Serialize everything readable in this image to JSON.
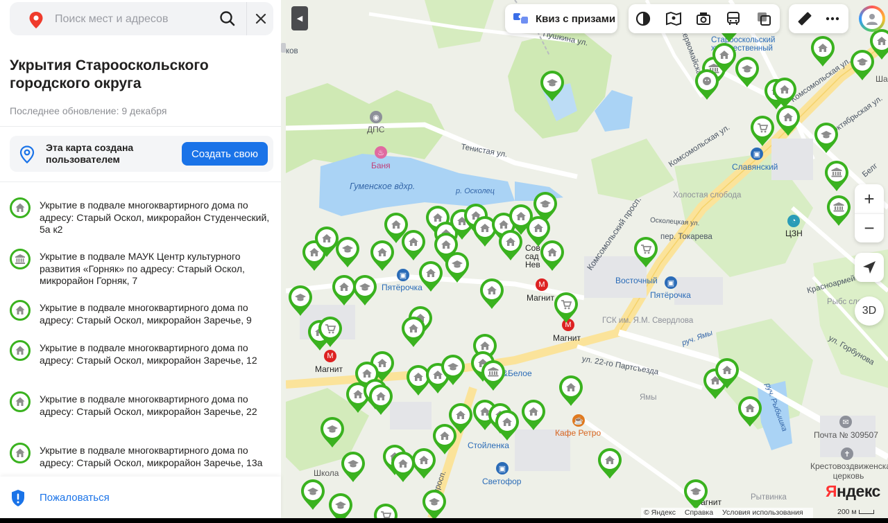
{
  "search": {
    "placeholder": "Поиск мест и адресов"
  },
  "sidebar": {
    "title": "Укрытия Старооскольского городского округа",
    "updated": "Последнее обновление: 9 декабря",
    "user_map_text": "Эта карта создана пользователем",
    "create_button": "Создать свою",
    "complain": "Пожаловаться",
    "items": [
      {
        "icon": "house-icon",
        "text": "Укрытие в подвале многоквартирного дома по адресу: Старый Оскол, микрорайон Студенческий, 5а к2"
      },
      {
        "icon": "museum-icon",
        "text": "Укрытие в подвале МАУК Центр культурного развития «Горняк» по адресу: Старый Оскол, микрорайон Горняк, 7"
      },
      {
        "icon": "house-icon",
        "text": "Укрытие в подвале многоквартирного дома по адресу: Старый Оскол, микрорайон Заречье, 9"
      },
      {
        "icon": "house-icon",
        "text": "Укрытие в подвале многоквартирного дома по адресу: Старый Оскол, микрорайон Заречье, 12"
      },
      {
        "icon": "house-icon",
        "text": "Укрытие в подвале многоквартирного дома по адресу: Старый Оскол, микрорайон Заречье, 22"
      },
      {
        "icon": "house-icon",
        "text": "Укрытие в подвале многоквартирного дома по адресу: Старый Оскол, микрорайон Заречье, 13а"
      }
    ]
  },
  "map": {
    "quiz_label": "Квиз с призами",
    "zoom_in": "+",
    "zoom_out": "−",
    "btn_3d": "3D",
    "logo": "Яндекс",
    "footer": {
      "copyright": "© Яндекс",
      "help": "Справка",
      "terms": "Условия использования"
    },
    "scale": "200 м",
    "marker_color": "#3ab21f",
    "labels": {
      "tenistaya": "Тенистая ул.",
      "gumenskoe": "Гуменское вдхр.",
      "oskolets": "р. Осколец",
      "dps": "ДПС",
      "banya": "Баня",
      "pyaterochka1": "Пятёрочка",
      "pyaterochka2": "Пятёрочка",
      "magnit1": "Магнит",
      "magnit2": "Магнит",
      "magnit3": "Магнит",
      "magnit4": "Магнит",
      "komsomolsky": "Комсомольский просп.",
      "komsomolskaya": "Комсомольская ул.",
      "komsomolskaya2": "Комсомольская ул.",
      "oktyabrskaya": "Октябрьская ул.",
      "osk_naber": "Осколецкая ул.",
      "tokareva": "пер. Токарева",
      "vostochny": "Восточный",
      "slavyansky": "Славянский",
      "czn": "ЦЗН",
      "kholostaya": "Холостая слобода",
      "gsk": "ГСК им. Я.М. Свердлова",
      "partsyezda": "ул. 22-го Партсъезда",
      "ruch_yamy": "руч. Ямы",
      "yamy": "Ямы",
      "ruch_rybyshka": "руч. Рыбышка",
      "gorbunova": "ул. Горбунова",
      "krasnoarm": "Красноармейская",
      "pochta": "Почта № 309507",
      "church": "Крестовоздвиженская церковь",
      "cafe": "Кафе Ретро",
      "stoylenka": "Стойленка",
      "svetofor": "Светофор",
      "krasnoe": "&Белое",
      "school": "Школа",
      "rytvinka": "Рытвинка",
      "pervomayskaya": "Первомайская ул.",
      "pushkina": "Пушкина ул.",
      "starooskolsky": "Старооскольский художественный",
      "rybs": "Рыбс слоб",
      "prosp": "просп.",
      "shk": "Ша",
      "belg": "Белг",
      "kov": "ков",
      "sov": "Сов сад Нев"
    }
  }
}
